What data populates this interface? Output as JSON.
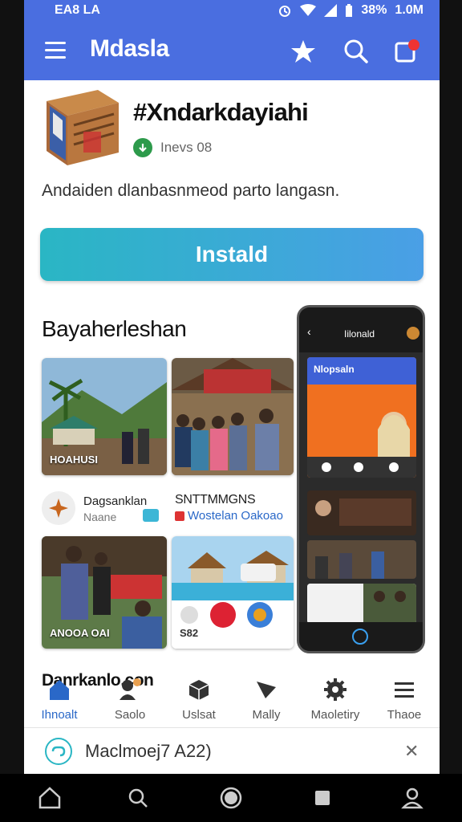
{
  "status_bar": {
    "left_text": "EA8 LA",
    "battery": "38%",
    "speed": "1.0M"
  },
  "app_bar": {
    "title": "Mdasla"
  },
  "app": {
    "name": "#Xndarkdayiahi",
    "verified_text": "Inevs 08",
    "description": "Andaiden dlanbasnmeod parto langasn.",
    "install_label": "Instald"
  },
  "screenshots": {
    "section_title": "Bayaherleshan",
    "row1": [
      {
        "caption": "HOAHUSI"
      },
      {
        "caption": ""
      }
    ],
    "meta_left": {
      "name": "Dagsanklan",
      "sub": "Naane"
    },
    "meta_right": {
      "name": "SNTTMMGNS",
      "sub": "Wostelan Oakoao"
    },
    "row2": [
      {
        "caption": "ANOOA OAI"
      },
      {
        "caption": "S82"
      }
    ]
  },
  "phone_mockup": {
    "title": "Iilonald",
    "card_title": "Nlopsaln"
  },
  "bottom_section_title": "Danrkanlo.con",
  "tabs": [
    {
      "label": "Ihnoalt",
      "icon": "home-icon",
      "active": true
    },
    {
      "label": "Saolo",
      "icon": "user-icon",
      "active": false
    },
    {
      "label": "Uslsat",
      "icon": "box-icon",
      "active": false
    },
    {
      "label": "Mally",
      "icon": "send-icon",
      "active": false
    },
    {
      "label": "Maoletiry",
      "icon": "gear-icon",
      "active": false
    },
    {
      "label": "Thaoe",
      "icon": "menu-icon",
      "active": false
    }
  ],
  "banner": {
    "text": "Maclmoej7 A22)"
  },
  "colors": {
    "primary": "#4a6ee0",
    "install_start": "#2ab6c4",
    "install_end": "#4a9fe6",
    "verified": "#2d9a4b"
  }
}
